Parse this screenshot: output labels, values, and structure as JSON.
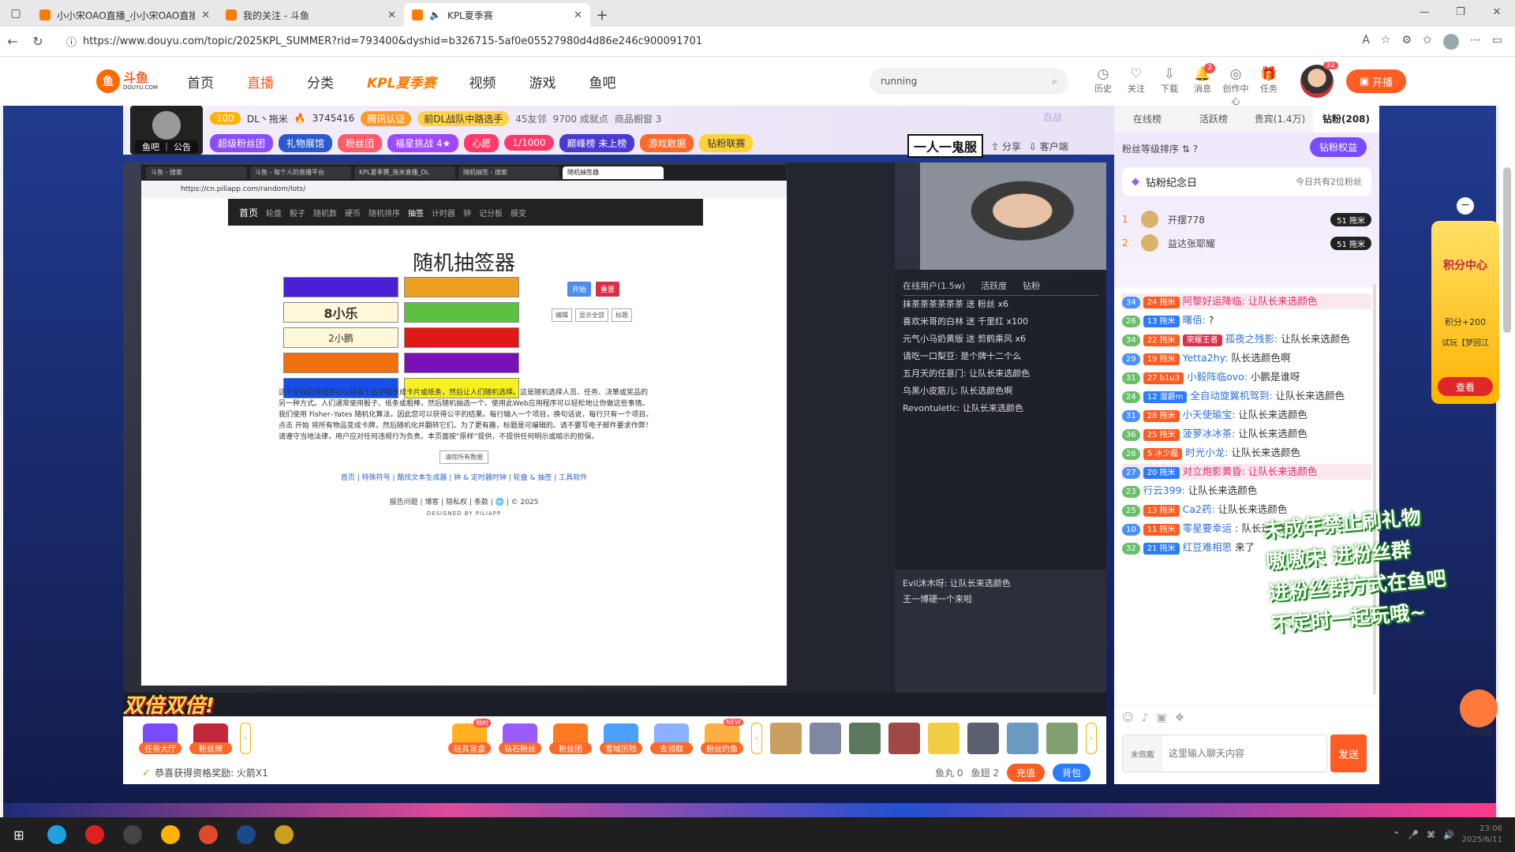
{
  "browser": {
    "tabs": [
      {
        "title": "小小宋OAO直播_小小宋OAO直播",
        "active": false
      },
      {
        "title": "我的关注 - 斗鱼",
        "active": false
      },
      {
        "title": "KPL夏季赛",
        "active": true
      }
    ],
    "url": "https://www.douyu.com/topic/2025KPL_SUMMER?rid=793400&dyshid=b326715-5af0e05527980d4d86e246c900091701"
  },
  "header": {
    "logo_text": "斗鱼",
    "logo_sub": "DOUYU.COM",
    "nav": [
      "首页",
      "直播",
      "分类",
      "KPL夏季赛",
      "视频",
      "游戏",
      "鱼吧"
    ],
    "search_value": "running",
    "icons": [
      {
        "label": "历史",
        "icon": "history-icon"
      },
      {
        "label": "关注",
        "icon": "heart-icon"
      },
      {
        "label": "下载",
        "icon": "download-icon"
      },
      {
        "label": "消息",
        "icon": "bell-icon",
        "badge": "2"
      },
      {
        "label": "创作中心",
        "icon": "bulb-icon"
      },
      {
        "label": "任务",
        "icon": "gift-icon"
      }
    ],
    "avatar_badge": "32",
    "kaibo": "开播"
  },
  "room": {
    "avatar_tag": "鱼吧 ｜ 公告",
    "level": "100",
    "name": "DL丶拖米",
    "heat": "3745416",
    "auth": "腾讯认证",
    "title": "前DL战队中路选手",
    "fans": "45友邻",
    "achievements": "9700 成就点",
    "goods": "商品橱窗 3",
    "pills": [
      "超级粉丝团",
      "礼物展馆",
      "粉丝团",
      "福星挑战 4★",
      "心愿",
      "1/1000",
      "巅峰榜 未上榜",
      "游戏数据",
      "钻粉联赛"
    ],
    "banner": "一人一鬼服",
    "share": "分享",
    "client": "客户端",
    "baizhan": "百战"
  },
  "inner_browser": {
    "tabs": [
      "斗鱼 - 搜索",
      "斗鱼 - 每个人的直播平台",
      "KPL夏季赛_拖米直播_DL",
      "随机抽签 - 搜索",
      "随机抽签器"
    ],
    "url": "https://cn.piliapp.com/random/lots/",
    "nav": [
      "首页",
      "轮盘",
      "骰子",
      "随机数",
      "硬币",
      "随机排序",
      "抽签",
      "计时器",
      "钟",
      "记分板",
      "膜变"
    ],
    "title": "随机抽签器",
    "cells": [
      {
        "text": "",
        "color": "#4a1fd6"
      },
      {
        "text": "",
        "color": "#f0a020"
      },
      {
        "text": "8小乐",
        "color": "#fff8d8",
        "big": true
      },
      {
        "text": "",
        "color": "#5cc040"
      },
      {
        "text": "2小鹏",
        "color": "#fff8d8"
      },
      {
        "text": "",
        "color": "#e01818"
      },
      {
        "text": "",
        "color": "#f07010"
      },
      {
        "text": "",
        "color": "#7a10b8"
      },
      {
        "text": "",
        "color": "#1450e8"
      },
      {
        "text": "",
        "color": "#f8f020"
      }
    ],
    "buttons": [
      {
        "label": "开始",
        "color": "#4a8cf0"
      },
      {
        "label": "重置",
        "color": "#d9304a"
      }
    ],
    "buttons2": [
      "编辑",
      "显示全部",
      "标题"
    ],
    "desc": "这个在线应用程序可以将多个名字制作成卡片或纸条，然后让人们随机选择。这是随机选择人员、任务、决策或奖品的另一种方式。人们通常使用骰子、纸条或粗棒，然后随机抽选一个。使用此Web应用程序可以轻松地让你做这些事情。我们使用 Fisher–Yates 随机化算法，因此您可以获得公平的结果。每行输入一个项目，换句话说，每行只有一个项目。点击 开始 将所有物品变成卡牌，然后随机化并翻转它们。为了更有趣，标题是可编辑的。请不要写电子邮件要求作弊！请遵守当地法律，用户应对任何违规行为负责。本页面按“原样”提供，不提供任何明示或暗示的担保。",
    "clear": "清除所有数据",
    "links1": "首页 | 特殊符号 | 酷炫文本生成器 | 钟 & 定时器时钟 | 轮盘 & 抽签 | 工具软件",
    "links2": "报告问题 | 博客 | 隐私权 | 条款 | 🌐 | © 2025",
    "footer": "DESIGNED BY PILIAPP"
  },
  "obs": {
    "header": [
      "在线用户(1.5w)",
      "活跃度",
      "钻粉"
    ],
    "lines": [
      "抹茶茶茶茶茶茶 送 粉丝 x6",
      "喜欢米哥的白林 送 千里红 x100",
      "元气小马奶黄版 送 剪鹤乘风 x6",
      "请吃一口梨豆: 是个牌十二个么",
      "五月天的任意门: 让队长来选颜色",
      "乌黑小皮筋儿: 队长选颜色啊",
      "Revontuletlc: 让队长来选颜色",
      "Evil沐木呀: 让队长来选颜色",
      "王一博硬一个来啦"
    ],
    "double_text": "双倍双倍!"
  },
  "gifts": [
    {
      "label": "任务大厅",
      "color": "#7a4cff"
    },
    {
      "label": "粉丝牌",
      "color": "#c0283a"
    },
    {
      "label": "玩具盲盒",
      "tag": "限时",
      "color": "#ffb020"
    },
    {
      "label": "钻石粉丝",
      "color": "#9a5cff"
    },
    {
      "label": "粉丝团",
      "color": "#ff7a20"
    },
    {
      "label": "雪域历险",
      "color": "#4aa0ff"
    },
    {
      "label": "去领取",
      "color": "#8ab0ff"
    },
    {
      "label": "粉丝约鱼",
      "tag": "NEW",
      "color": "#ffb040"
    }
  ],
  "gift_thumbs": [
    "#c9a060",
    "#8088a0",
    "#5a7a60",
    "#a04848",
    "#f0d040",
    "#5a6070",
    "#6a9ac0",
    "#80a070"
  ],
  "bottombar": {
    "notice": "恭喜获得资格奖励: 火箭X1",
    "yuwan": "鱼丸 0",
    "yuchi": "鱼翅 2",
    "recharge": "充值",
    "backpack": "背包"
  },
  "rpanel": {
    "tabs": [
      "在线榜",
      "活跃榜",
      "贵宾(1.4万)",
      "钻粉(208)"
    ],
    "sort_label": "粉丝等级排序",
    "diamond_btn": "钻粉权益",
    "memorial": "钻粉纪念日",
    "memorial_sub": "今日共有2位粉丝",
    "rank": [
      {
        "no": "1",
        "name": "开摆778",
        "badge": "51 拖米"
      },
      {
        "no": "2",
        "name": "益达张耶耀",
        "badge": "51 拖米"
      }
    ],
    "messages": [
      {
        "lv": "34",
        "fan": "24 拖米",
        "name": "阿黎好运降临:",
        "text": "让队长来选颜色",
        "hl": true
      },
      {
        "lv": "26",
        "fan": "13 拖米",
        "name": "曙佰:",
        "text": "?"
      },
      {
        "lv": "34",
        "fan": "22 拖米",
        "name": "孤夜之残影:",
        "text": "让队长来选颜色",
        "extra": "荣耀王者"
      },
      {
        "lv": "29",
        "fan": "19 拖米",
        "name": "Yetta2hy:",
        "text": "队长选颜色啊"
      },
      {
        "lv": "31",
        "fan": "27 b1u3",
        "name": "小毅阵临ovo:",
        "text": "小鹏是谁呀"
      },
      {
        "lv": "24",
        "fan": "12 溜爵m",
        "name": "全自动旋翼机驾到:",
        "text": "让队长来选颜色"
      },
      {
        "lv": "31",
        "fan": "28 拖米",
        "name": "小天使瑜宝:",
        "text": "让队长来选颜色"
      },
      {
        "lv": "36",
        "fan": "25 拖米",
        "name": "菠萝冰冰茶:",
        "text": "让队长来选颜色"
      },
      {
        "lv": "26",
        "fan": "5 冰少磊",
        "name": "时光小龙:",
        "text": "让队长来选颜色"
      },
      {
        "lv": "27",
        "fan": "20 拖米",
        "name": "对立炮影黄昏:",
        "text": "让队长来选颜色",
        "hl": true
      },
      {
        "lv": "23",
        "fan": "",
        "name": "行云399:",
        "text": "让队长来选颜色"
      },
      {
        "lv": "25",
        "fan": "13 拖米",
        "name": "Ca2药:",
        "text": "让队长来选颜色"
      },
      {
        "lv": "10",
        "fan": "11 拖米",
        "name": "零星要幸运",
        "text": ": 队长选颜色啊"
      },
      {
        "lv": "32",
        "fan": "21 拖米",
        "name": "红豆难相思",
        "text": "来了"
      }
    ],
    "input_placeholder": "这里输入聊天内容",
    "input_who": "未佩戴",
    "send": "发送"
  },
  "widgets": {
    "points_title": "积分中心",
    "points_value": "积分+200",
    "points_sub": "试玩【梦回江",
    "points_btn": "查看",
    "support": "活动客服",
    "overlay": [
      "未成年禁止刷礼物",
      "嗷嗷宋 进粉丝群",
      "进粉丝群方式在鱼吧",
      "不定时一起玩哦~"
    ]
  },
  "taskbar": {
    "time": "23:06",
    "date": "2025/6/11"
  }
}
